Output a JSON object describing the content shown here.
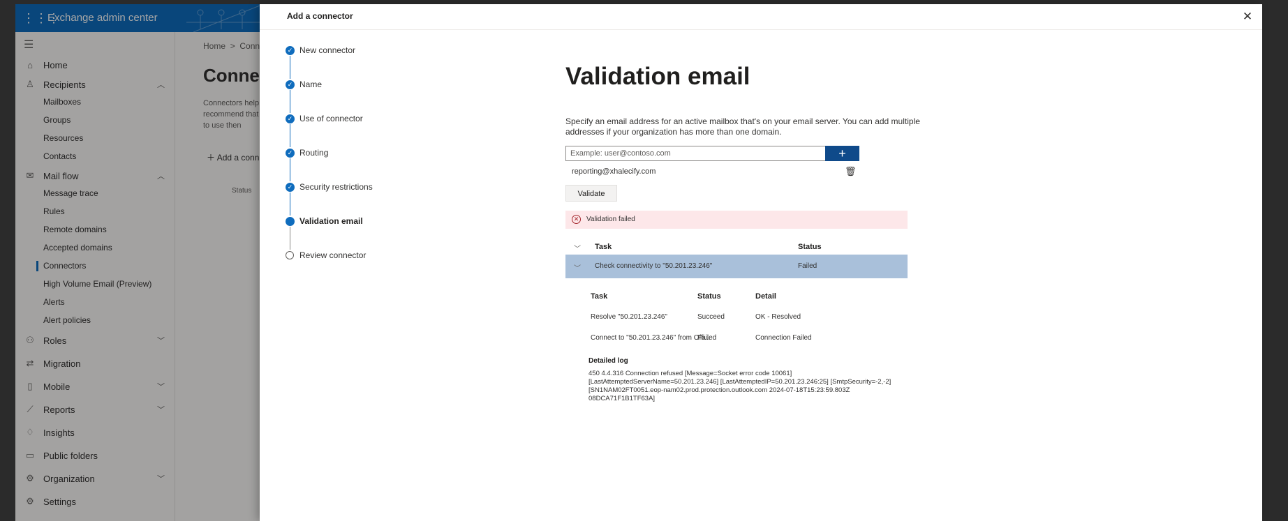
{
  "app": {
    "title": "Exchange admin center"
  },
  "nav": {
    "items": [
      {
        "label": "Home",
        "icon": "home-icon"
      },
      {
        "label": "Recipients",
        "icon": "person-icon"
      },
      {
        "label": "Mailboxes"
      },
      {
        "label": "Groups"
      },
      {
        "label": "Resources"
      },
      {
        "label": "Contacts"
      },
      {
        "label": "Mail flow",
        "icon": "mail-icon"
      },
      {
        "label": "Message trace"
      },
      {
        "label": "Rules"
      },
      {
        "label": "Remote domains"
      },
      {
        "label": "Accepted domains"
      },
      {
        "label": "Connectors"
      },
      {
        "label": "High Volume Email (Preview)"
      },
      {
        "label": "Alerts"
      },
      {
        "label": "Alert policies"
      },
      {
        "label": "Roles",
        "icon": "roles-icon"
      },
      {
        "label": "Migration",
        "icon": "migration-icon"
      },
      {
        "label": "Mobile",
        "icon": "mobile-icon"
      },
      {
        "label": "Reports",
        "icon": "reports-icon"
      },
      {
        "label": "Insights",
        "icon": "insights-icon"
      },
      {
        "label": "Public folders",
        "icon": "folder-icon"
      },
      {
        "label": "Organization",
        "icon": "organization-icon"
      },
      {
        "label": "Settings",
        "icon": "gear-icon"
      }
    ]
  },
  "page": {
    "breadcrumb_home": "Home",
    "breadcrumb_sep": ">",
    "breadcrumb_current": "Conn",
    "title": "Connect",
    "description": "Connectors help recommend that need to use then",
    "add_connector": "Add a conn",
    "status_header": "Status"
  },
  "panel": {
    "title": "Add a connector",
    "steps": [
      {
        "label": "New connector",
        "state": "done"
      },
      {
        "label": "Name",
        "state": "done"
      },
      {
        "label": "Use of connector",
        "state": "done"
      },
      {
        "label": "Routing",
        "state": "done"
      },
      {
        "label": "Security restrictions",
        "state": "done"
      },
      {
        "label": "Validation email",
        "state": "current"
      },
      {
        "label": "Review connector",
        "state": "todo"
      }
    ],
    "heading": "Validation email",
    "description": "Specify an email address for an active mailbox that's on your email server. You can add multiple addresses if your organization has more than one domain.",
    "input_placeholder": "Example: user@contoso.com",
    "added_email": "reporting@xhalecify.com",
    "validate_label": "Validate",
    "error_text": "Validation failed",
    "table": {
      "task_header": "Task",
      "status_header": "Status",
      "row_task": "Check connectivity to \"50.201.23.246\"",
      "row_status": "Failed"
    },
    "subtable": {
      "headers": [
        "Task",
        "Status",
        "Detail"
      ],
      "rows": [
        [
          "Resolve \"50.201.23.246\"",
          "Succeed",
          "OK - Resolved"
        ],
        [
          "Connect to \"50.201.23.246\" from Offi...",
          "Failed",
          "Connection Failed"
        ]
      ]
    },
    "log_title": "Detailed log",
    "log_text": "450 4.4.316 Connection refused [Message=Socket error code 10061] [LastAttemptedServerName=50.201.23.246] [LastAttemptedIP=50.201.23.246:25] [SmtpSecurity=-2,-2] [SN1NAM02FT0051.eop-nam02.prod.protection.outlook.com 2024-07-18T15:23:59.803Z 08DCA71F1B1TF63A]"
  },
  "colors": {
    "brand": "#0f6cbd",
    "add_button": "#0f4a8a",
    "error_bg": "#fde7e9",
    "selected_row": "#a9c0da"
  }
}
